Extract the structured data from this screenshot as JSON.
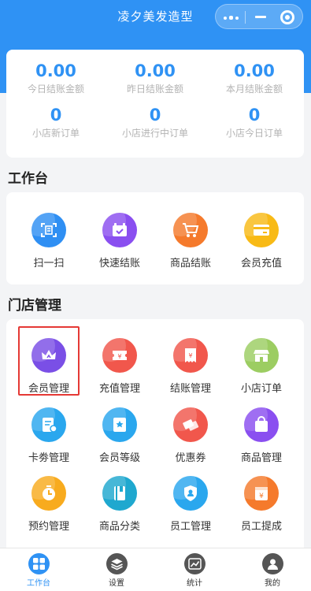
{
  "window": {
    "title": "凌夕美发造型"
  },
  "stats": [
    {
      "value": "0.00",
      "label": "今日结账金额"
    },
    {
      "value": "0.00",
      "label": "昨日结账金额"
    },
    {
      "value": "0.00",
      "label": "本月结账金额"
    },
    {
      "value": "0",
      "label": "小店新订单"
    },
    {
      "value": "0",
      "label": "小店进行中订单"
    },
    {
      "value": "0",
      "label": "小店今日订单"
    }
  ],
  "workbench": {
    "title": "工作台",
    "items": [
      {
        "label": "扫一扫",
        "icon": "scan-icon",
        "color": "#2f8ff3"
      },
      {
        "label": "快速结账",
        "icon": "wallet-icon",
        "color": "#8a4ff0"
      },
      {
        "label": "商品结账",
        "icon": "cart-icon",
        "color": "#f57a2c"
      },
      {
        "label": "会员充值",
        "icon": "card-icon",
        "color": "#f8ba16"
      }
    ]
  },
  "store": {
    "title": "门店管理",
    "items": [
      {
        "label": "会员管理",
        "icon": "crown-icon",
        "color": "#7a4fe6"
      },
      {
        "label": "充值管理",
        "icon": "ticket-icon",
        "color": "#f1574c"
      },
      {
        "label": "结账管理",
        "icon": "bill-icon",
        "color": "#f1574c"
      },
      {
        "label": "小店订单",
        "icon": "shop-icon",
        "color": "#9ccd62"
      },
      {
        "label": "卡劵管理",
        "icon": "coupon-list-icon",
        "color": "#2aa7ee"
      },
      {
        "label": "会员等级",
        "icon": "badge-icon",
        "color": "#2aa7ee"
      },
      {
        "label": "优惠券",
        "icon": "tickets-icon",
        "color": "#f1574c"
      },
      {
        "label": "商品管理",
        "icon": "bag-icon",
        "color": "#8a4ff0"
      },
      {
        "label": "预约管理",
        "icon": "clock-icon",
        "color": "#f8ab1e"
      },
      {
        "label": "商品分类",
        "icon": "book-icon",
        "color": "#1fa8cf"
      },
      {
        "label": "员工管理",
        "icon": "shield-user-icon",
        "color": "#2aa7ee"
      },
      {
        "label": "员工提成",
        "icon": "money-box-icon",
        "color": "#f57a2c"
      }
    ]
  },
  "tabbar": [
    {
      "label": "工作台",
      "icon": "grid-icon",
      "color": "#2f92f4",
      "active": true
    },
    {
      "label": "设置",
      "icon": "layers-icon",
      "color": "#555555",
      "active": false
    },
    {
      "label": "统计",
      "icon": "chart-icon",
      "color": "#555555",
      "active": false
    },
    {
      "label": "我的",
      "icon": "user-icon",
      "color": "#555555",
      "active": false
    }
  ],
  "accent": "#2f92f4",
  "highlight_color": "#e53935"
}
